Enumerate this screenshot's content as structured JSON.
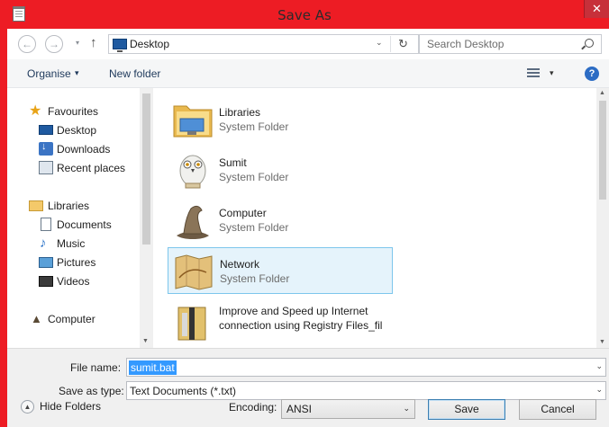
{
  "window": {
    "title": "Save As",
    "close_glyph": "✕",
    "icon": "notepad-icon",
    "frame_color": "#ed1c24"
  },
  "navigation": {
    "back_glyph": "←",
    "forward_glyph": "→",
    "recent_glyph": "▾",
    "up_glyph": "↑",
    "address": "Desktop",
    "address_dropdown_glyph": "⌄",
    "refresh_glyph": "↻",
    "search_placeholder": "Search Desktop"
  },
  "toolbar": {
    "organise_label": "Organise",
    "organise_caret": "▾",
    "new_folder_label": "New folder",
    "view_caret": "▾",
    "help_glyph": "?"
  },
  "nav_pane": {
    "favourites": {
      "label": "Favourites",
      "items": [
        {
          "label": "Desktop",
          "icon": "desktop-icon"
        },
        {
          "label": "Downloads",
          "icon": "downloads-icon"
        },
        {
          "label": "Recent places",
          "icon": "recent-places-icon"
        }
      ]
    },
    "libraries": {
      "label": "Libraries",
      "items": [
        {
          "label": "Documents",
          "icon": "documents-icon"
        },
        {
          "label": "Music",
          "icon": "music-icon"
        },
        {
          "label": "Pictures",
          "icon": "pictures-icon"
        },
        {
          "label": "Videos",
          "icon": "videos-icon"
        }
      ]
    },
    "computer": {
      "label": "Computer",
      "icon": "computer-icon"
    },
    "star_glyph": "★",
    "music_glyph": "♪",
    "computer_glyph": "▲"
  },
  "content": {
    "items": [
      {
        "name": "Libraries",
        "type": "System Folder",
        "icon": "libraries-folder-icon",
        "selected": false
      },
      {
        "name": "Sumit",
        "type": "System Folder",
        "icon": "user-owl-icon",
        "selected": false
      },
      {
        "name": "Computer",
        "type": "System Folder",
        "icon": "sorting-hat-icon",
        "selected": false
      },
      {
        "name": "Network",
        "type": "System Folder",
        "icon": "network-map-icon",
        "selected": true
      },
      {
        "name_line1": "Improve and Speed up Internet",
        "name_line2": "connection using Registry Files_fil",
        "icon": "archive-file-icon"
      }
    ],
    "selection_color": "#e5f3fb"
  },
  "form": {
    "file_name_label": "File name:",
    "file_name_value": "sumit.bat",
    "save_type_label": "Save as type:",
    "save_type_value": "Text Documents (*.txt)",
    "combo_caret": "⌄"
  },
  "footer": {
    "hide_folders_label": "Hide Folders",
    "hide_folders_glyph": "▲",
    "encoding_label": "Encoding:",
    "encoding_value": "ANSI",
    "encoding_caret": "⌄",
    "save_label": "Save",
    "cancel_label": "Cancel"
  },
  "scroll": {
    "up_glyph": "▲",
    "down_glyph": "▼"
  }
}
